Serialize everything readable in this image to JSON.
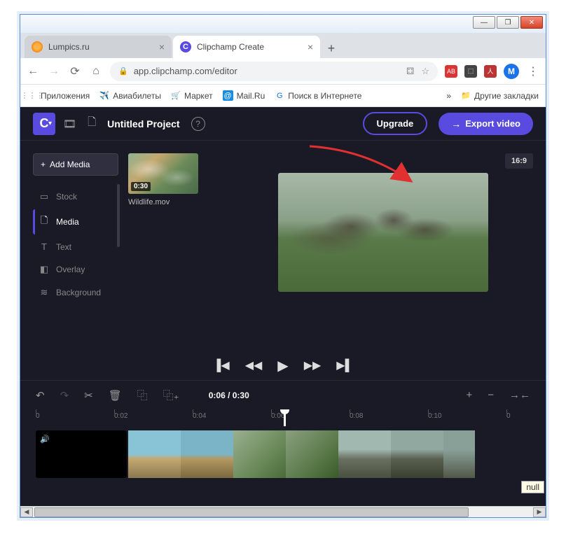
{
  "window": {
    "minimize": "—",
    "maximize": "❐",
    "close": "✕"
  },
  "tabs": [
    {
      "title": "Lumpics.ru",
      "active": false
    },
    {
      "title": "Clipchamp Create",
      "active": true
    }
  ],
  "address": {
    "url": "app.clipchamp.com/editor"
  },
  "bookmarks": {
    "apps": "Приложения",
    "items": [
      "Авиабилеты",
      "Маркет",
      "Mail.Ru",
      "Поиск в Интернете"
    ],
    "more": "»",
    "other": "Другие закладки"
  },
  "header": {
    "logo": "C",
    "project": "Untitled Project",
    "upgrade": "Upgrade",
    "export": "Export video"
  },
  "sidebar": {
    "add": "Add Media",
    "items": [
      {
        "icon": "▭",
        "label": "Stock"
      },
      {
        "icon": "🗋",
        "label": "Media",
        "active": true
      },
      {
        "icon": "T",
        "label": "Text"
      },
      {
        "icon": "◧",
        "label": "Overlay"
      },
      {
        "icon": "≋",
        "label": "Background"
      }
    ]
  },
  "media": {
    "duration": "0:30",
    "name": "Wildlife.mov"
  },
  "preview": {
    "aspect": "16:9"
  },
  "playback": {
    "prev": "▐◀",
    "rew": "◀◀",
    "play": "▶",
    "ff": "▶▶",
    "next": "▶▌"
  },
  "timeline": {
    "time": "0:06 / 0:30",
    "marks": [
      "0",
      "0:02",
      "0:04",
      "0:06",
      "0:08",
      "0:10",
      "0"
    ]
  },
  "footer": {
    "null": "null"
  }
}
